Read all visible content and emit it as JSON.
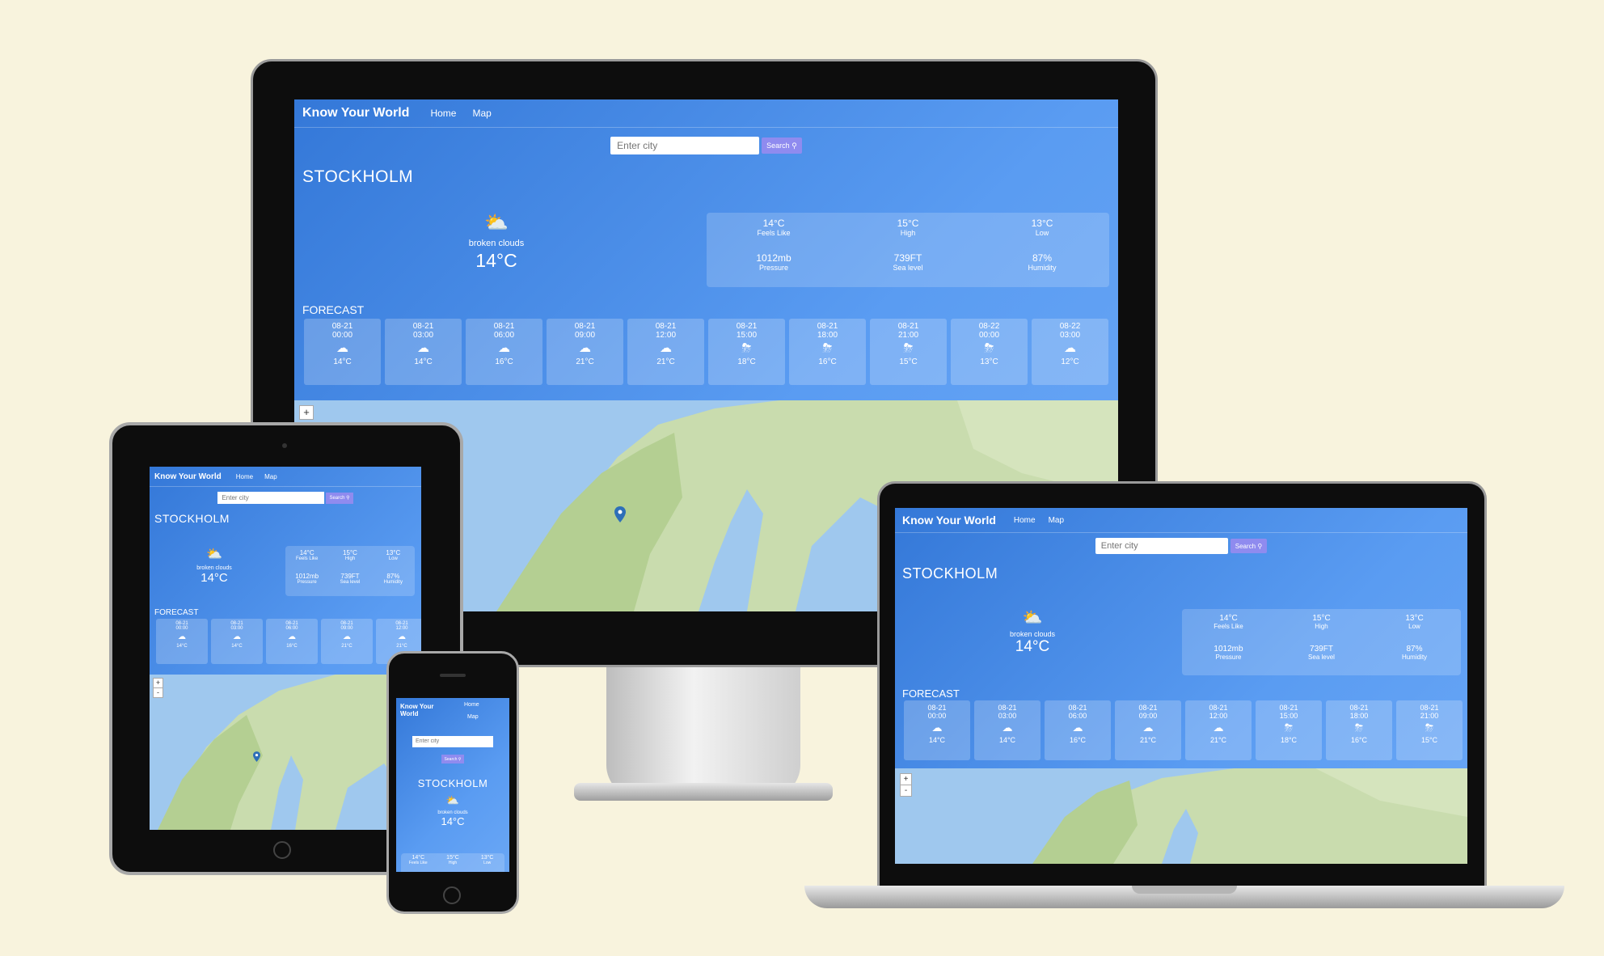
{
  "app": {
    "brand": "Know Your World",
    "brand_mobile_l1": "Know Your",
    "brand_mobile_l2": "World",
    "nav_home": "Home",
    "nav_map": "Map",
    "search_placeholder": "Enter city",
    "search_label": "Search"
  },
  "weather": {
    "city": "STOCKHOLM",
    "description": "broken clouds",
    "temp": "14°C",
    "details": [
      {
        "value": "14°C",
        "label": "Feels Like"
      },
      {
        "value": "15°C",
        "label": "High"
      },
      {
        "value": "13°C",
        "label": "Low"
      },
      {
        "value": "1012mb",
        "label": "Pressure"
      },
      {
        "value": "739FT",
        "label": "Sea level"
      },
      {
        "value": "87%",
        "label": "Humidity"
      }
    ]
  },
  "forecast": {
    "heading": "FORECAST",
    "items": [
      {
        "date": "08-21",
        "time": "00:00",
        "temp": "14°C",
        "icon": "broken-clouds-icon"
      },
      {
        "date": "08-21",
        "time": "03:00",
        "temp": "14°C",
        "icon": "broken-clouds-icon"
      },
      {
        "date": "08-21",
        "time": "06:00",
        "temp": "16°C",
        "icon": "broken-clouds-icon"
      },
      {
        "date": "08-21",
        "time": "09:00",
        "temp": "21°C",
        "icon": "few-clouds-icon"
      },
      {
        "date": "08-21",
        "time": "12:00",
        "temp": "21°C",
        "icon": "broken-clouds-icon"
      },
      {
        "date": "08-21",
        "time": "15:00",
        "temp": "18°C",
        "icon": "rain-icon"
      },
      {
        "date": "08-21",
        "time": "18:00",
        "temp": "16°C",
        "icon": "rain-icon"
      },
      {
        "date": "08-21",
        "time": "21:00",
        "temp": "15°C",
        "icon": "rain-icon"
      },
      {
        "date": "08-22",
        "time": "00:00",
        "temp": "13°C",
        "icon": "rain-icon"
      },
      {
        "date": "08-22",
        "time": "03:00",
        "temp": "12°C",
        "icon": "broken-clouds-icon"
      }
    ]
  },
  "map": {
    "zoom_in": "+",
    "zoom_out": "-"
  },
  "colors": {
    "background": "#f8f3dd",
    "gradient_start": "#3478d8",
    "gradient_end": "#6aa7f5",
    "search_button": "#8f8bef"
  }
}
